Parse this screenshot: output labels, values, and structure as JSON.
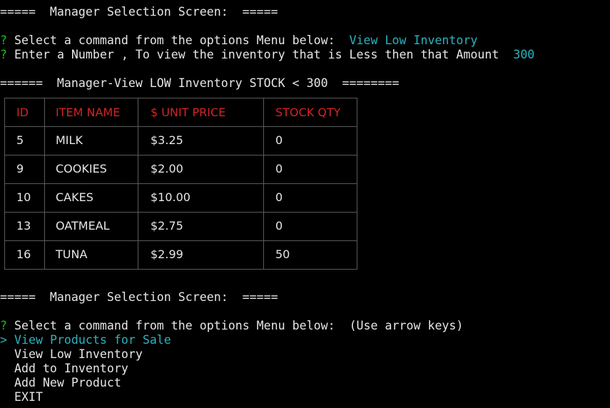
{
  "session1": {
    "banner": "=====  Manager Selection Screen:  =====",
    "prompt1": {
      "mark": "?",
      "question": "Select a command from the options Menu below:",
      "answer": "View Low Inventory"
    },
    "prompt2": {
      "mark": "?",
      "question": "Enter a Number , To view the inventory that is Less then that Amount",
      "answer": "300"
    },
    "report_title": "======  Manager-View LOW Inventory STOCK < 300  ========"
  },
  "table": {
    "headers": [
      "ID",
      "ITEM NAME",
      "$ UNIT PRICE",
      "STOCK QTY"
    ],
    "rows": [
      [
        "5",
        "MILK",
        "$3.25",
        "0"
      ],
      [
        "9",
        "COOKIES",
        "$2.00",
        "0"
      ],
      [
        "10",
        "CAKES",
        "$10.00",
        "0"
      ],
      [
        "13",
        "OATMEAL",
        "$2.75",
        "0"
      ],
      [
        "16",
        "TUNA",
        "$2.99",
        "50"
      ]
    ]
  },
  "session2": {
    "banner": "=====  Manager Selection Screen:  =====",
    "prompt": {
      "mark": "?",
      "question": "Select a command from the options Menu below:",
      "hint": "(Use arrow keys)"
    },
    "cursor": ">",
    "menu": [
      "View Products for Sale",
      "View Low Inventory",
      "Add to Inventory",
      "Add New Product",
      "EXIT"
    ],
    "selected_index": 0
  },
  "colors": {
    "background": "#000000",
    "text": "#e6e6e6",
    "prompt_mark": "#13c413",
    "answer": "#2ab3c0",
    "table_header": "#d42424",
    "table_border": "#5a5a5a"
  }
}
